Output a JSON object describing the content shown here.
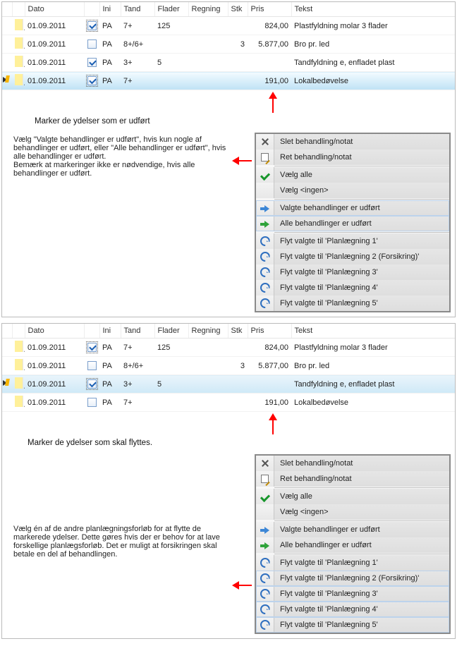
{
  "columns": {
    "dato": "Dato",
    "ini": "Ini",
    "tand": "Tand",
    "flader": "Flader",
    "regning": "Regning",
    "stk": "Stk",
    "pris": "Pris",
    "tekst": "Tekst"
  },
  "rows1": [
    {
      "edit": false,
      "dato": "01.09.2011",
      "chk": true,
      "chkDotted": true,
      "ini": "PA",
      "tand": "7+",
      "flader": "125",
      "regning": "",
      "stk": "",
      "pris": "824,00",
      "tekst": "Plastfyldning molar 3 flader",
      "cls": ""
    },
    {
      "edit": false,
      "dato": "01.09.2011",
      "chk": false,
      "chkDotted": false,
      "ini": "PA",
      "tand": "8+/6+",
      "flader": "",
      "regning": "",
      "stk": "3",
      "pris": "5.877,00",
      "tekst": "Bro pr. led",
      "cls": ""
    },
    {
      "edit": false,
      "dato": "01.09.2011",
      "chk": true,
      "chkDotted": false,
      "ini": "PA",
      "tand": "3+",
      "flader": "5",
      "regning": "",
      "stk": "",
      "pris": "",
      "tekst": "Tandfyldning e, enfladet plast",
      "cls": ""
    },
    {
      "edit": true,
      "dato": "01.09.2011",
      "chk": true,
      "chkDotted": true,
      "ini": "PA",
      "tand": "7+",
      "flader": "",
      "regning": "",
      "stk": "",
      "pris": "191,00",
      "tekst": "Lokalbedøvelse",
      "cls": "row-bluebar"
    }
  ],
  "rows2": [
    {
      "edit": false,
      "dato": "01.09.2011",
      "chk": true,
      "chkDotted": true,
      "ini": "PA",
      "tand": "7+",
      "flader": "125",
      "regning": "",
      "stk": "",
      "pris": "824,00",
      "tekst": "Plastfyldning molar 3 flader",
      "cls": ""
    },
    {
      "edit": false,
      "dato": "01.09.2011",
      "chk": false,
      "chkDotted": false,
      "ini": "PA",
      "tand": "8+/6+",
      "flader": "",
      "regning": "",
      "stk": "3",
      "pris": "5.877,00",
      "tekst": "Bro pr. led",
      "cls": ""
    },
    {
      "edit": true,
      "dato": "01.09.2011",
      "chk": true,
      "chkDotted": true,
      "ini": "PA",
      "tand": "3+",
      "flader": "5",
      "regning": "",
      "stk": "",
      "pris": "",
      "tekst": "Tandfyldning e, enfladet plast",
      "cls": "row-sel"
    },
    {
      "edit": false,
      "dato": "01.09.2011",
      "chk": false,
      "chkDotted": false,
      "ini": "PA",
      "tand": "7+",
      "flader": "",
      "regning": "",
      "stk": "",
      "pris": "191,00",
      "tekst": "Lokalbedøvelse",
      "cls": ""
    }
  ],
  "caption1": "Marker de ydelser som er udført",
  "caption2": "Marker de ydelser som skal flyttes.",
  "para1": "Vælg \"Valgte behandlinger er udført\", hvis kun nogle af behandlinger er udført, eller \"Alle behandlinger er udført\", hvis alle behandlinger er udført.\nBemærk at markeringer ikke er nødvendige, hvis alle behandlinger er udført.",
  "para2": "Vælg én af de andre planlægningsforløb for at flytte de markerede ydelser. Dette gøres hvis der er behov for at lave forskellige planlægsforløb. Det er muligt at forsikringen skal betale en del af behandlingen.",
  "menu": {
    "del": "Slet behandling/notat",
    "edit": "Ret behandling/notat",
    "all": "Vælg alle",
    "none": "Vælg <ingen>",
    "sel": "Valgte behandlinger er udført",
    "alle": "Alle behandlinger er udført",
    "p1": "Flyt valgte til 'Planlægning 1'",
    "p2": "Flyt valgte til 'Planlægning 2 (Forsikring)'",
    "p3": "Flyt valgte til 'Planlægning 3'",
    "p4": "Flyt valgte til 'Planlægning 4'",
    "p5": "Flyt valgte til 'Planlægning 5'"
  }
}
